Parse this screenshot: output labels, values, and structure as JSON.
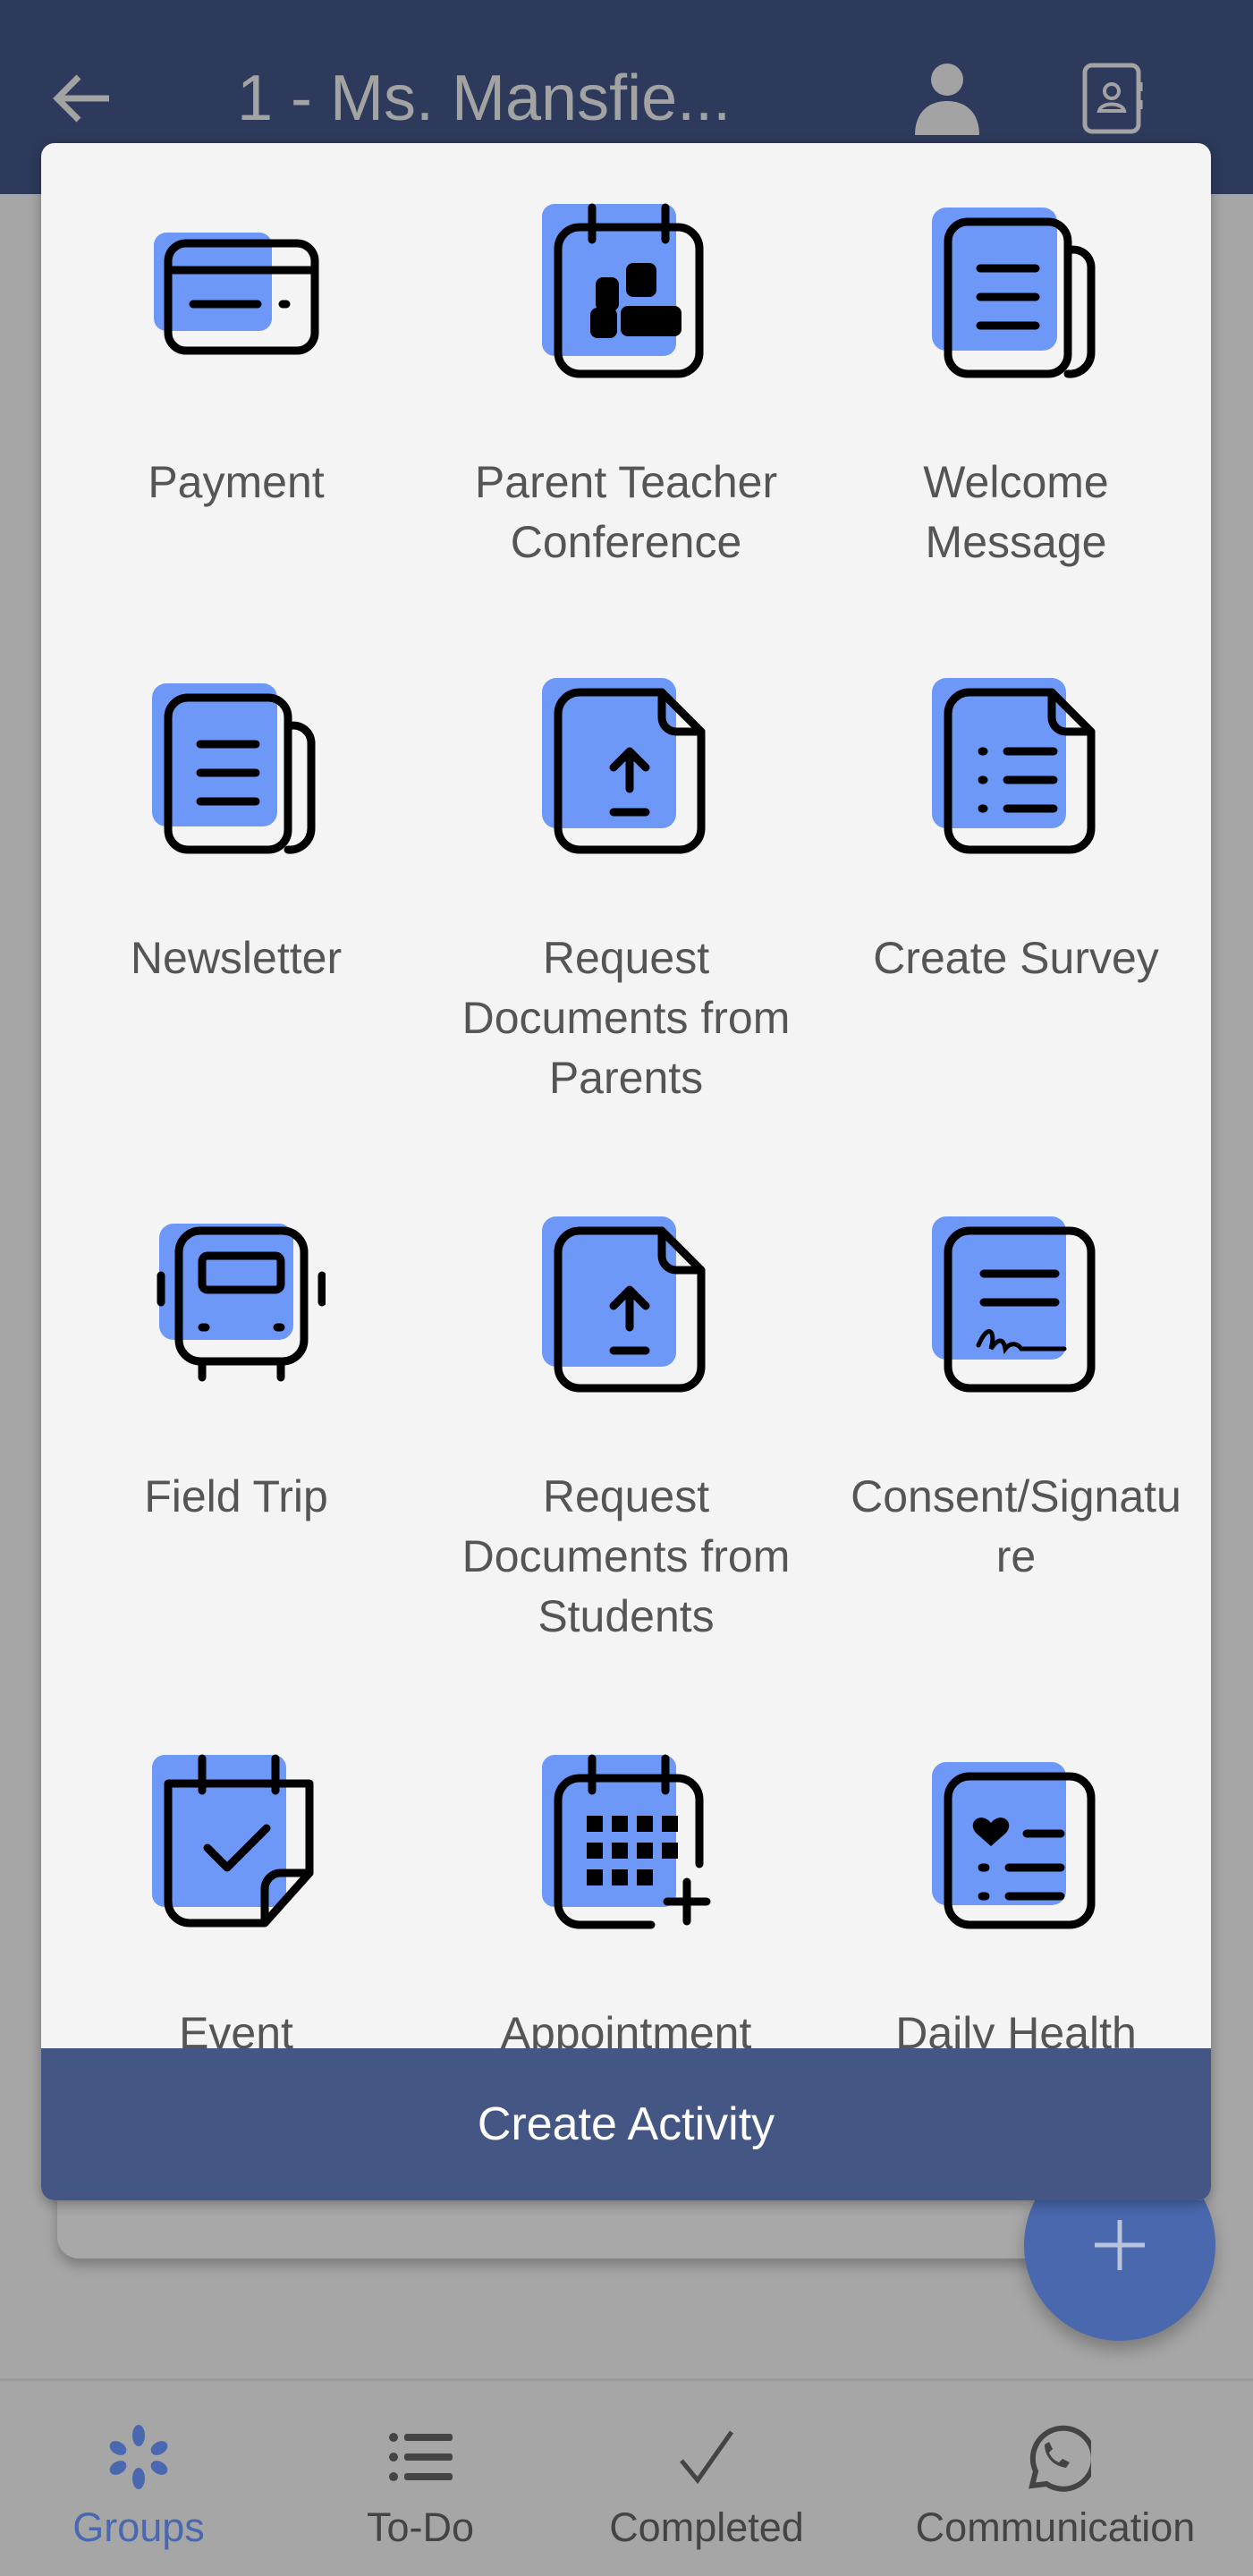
{
  "header": {
    "title": "1 - Ms. Mansfie...",
    "back_icon": "arrow-left-icon",
    "profile_icon": "person-icon",
    "contacts_icon": "contact-book-icon"
  },
  "colors": {
    "header": "#2d3a5b",
    "accent": "#6e98f8",
    "button": "#445683",
    "fab": "#4a68ae",
    "active_nav": "#4a68b0"
  },
  "activities": [
    {
      "label": "Payment",
      "icon": "credit-card-icon"
    },
    {
      "label": "Parent Teacher\nConference",
      "icon": "calendar-icon"
    },
    {
      "label": "Welcome\nMessage",
      "icon": "document-lines-icon"
    },
    {
      "label": "Newsletter",
      "icon": "newsletter-icon"
    },
    {
      "label": "Request\nDocuments from\nParents",
      "icon": "file-upload-icon"
    },
    {
      "label": "Create Survey",
      "icon": "survey-list-icon"
    },
    {
      "label": "Field Trip",
      "icon": "bus-icon"
    },
    {
      "label": "Request\nDocuments from\nStudents",
      "icon": "file-upload-icon"
    },
    {
      "label": "Consent/Signatu\nre",
      "icon": "signature-icon"
    },
    {
      "label": "Event",
      "icon": "calendar-check-icon"
    },
    {
      "label": "Appointment",
      "icon": "calendar-add-icon"
    },
    {
      "label": "Daily Health",
      "icon": "health-list-icon"
    }
  ],
  "create_button": "Create Activity",
  "fab_icon": "plus-icon",
  "nav": [
    {
      "label": "Groups",
      "icon": "groups-icon",
      "active": true
    },
    {
      "label": "To-Do",
      "icon": "list-icon",
      "active": false
    },
    {
      "label": "Completed",
      "icon": "check-icon",
      "active": false
    },
    {
      "label": "Communication",
      "icon": "whatsapp-icon",
      "active": false
    }
  ]
}
